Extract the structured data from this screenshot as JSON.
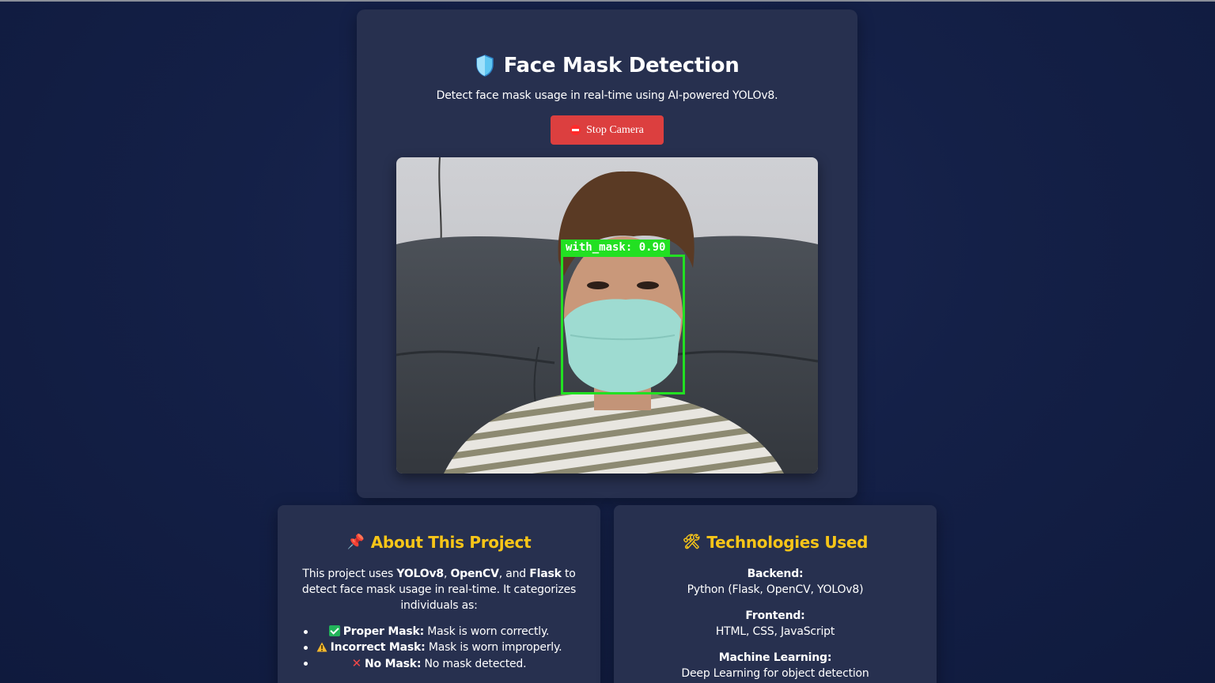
{
  "header": {
    "icon": "shield-icon",
    "title": "Face Mask Detection",
    "subtitle": "Detect face mask usage in real-time using AI-powered YOLOv8."
  },
  "controls": {
    "stop_icon": "minus-circle-icon",
    "stop_label": "Stop Camera"
  },
  "detection": {
    "label": "with_mask: 0.90",
    "class": "with_mask",
    "confidence": 0.9,
    "color": "#22e022"
  },
  "about": {
    "icon": "pushpin-icon",
    "title": "About This Project",
    "intro_1": "This project uses ",
    "tech_1": "YOLOv8",
    "sep_1": ", ",
    "tech_2": "OpenCV",
    "sep_2": ", and ",
    "tech_3": "Flask",
    "intro_2": " to detect face mask usage in real-time. It categorizes individuals as:",
    "categories": [
      {
        "icon": "check-icon",
        "name": "Proper Mask:",
        "desc": " Mask is worn correctly."
      },
      {
        "icon": "warning-icon",
        "name": "Incorrect Mask:",
        "desc": " Mask is worn improperly."
      },
      {
        "icon": "cross-icon",
        "name": "No Mask:",
        "desc": " No mask detected."
      }
    ]
  },
  "technologies": {
    "icon": "tools-icon",
    "title": "Technologies Used",
    "groups": [
      {
        "label": "Backend:",
        "value": "Python (Flask, OpenCV, YOLOv8)"
      },
      {
        "label": "Frontend:",
        "value": "HTML, CSS, JavaScript"
      },
      {
        "label": "Machine Learning:",
        "value": "Deep Learning for object detection"
      }
    ]
  },
  "colors": {
    "page_bg": "#142047",
    "card_bg": "#27304f",
    "accent_title": "#f7c518",
    "stop_button": "#dc3f3f"
  }
}
